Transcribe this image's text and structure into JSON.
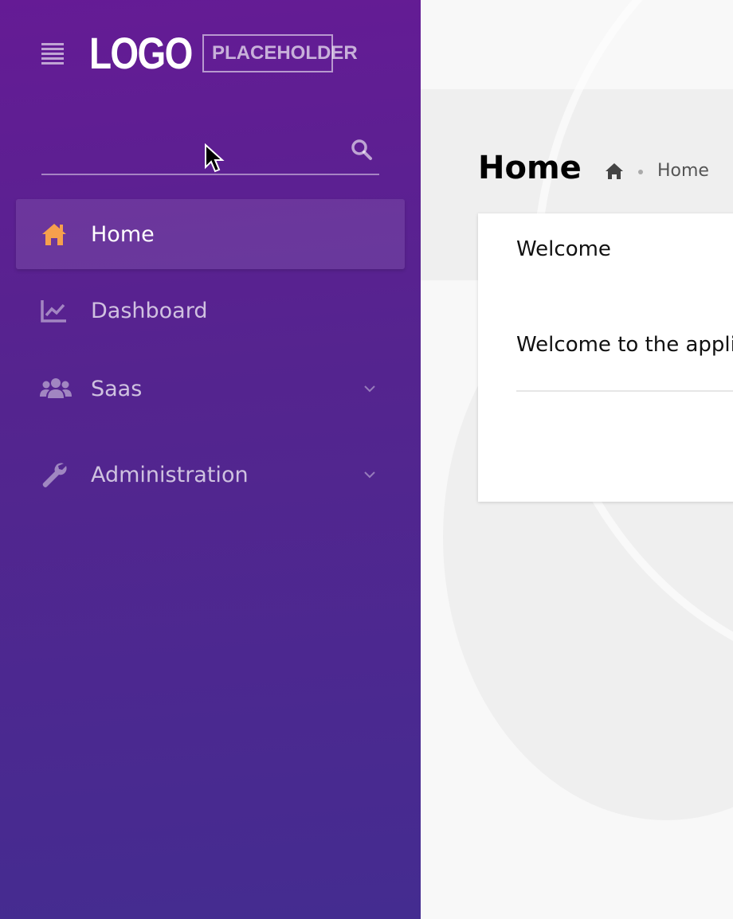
{
  "logo": {
    "main": "LOGO",
    "sub": "PLACEHOLDER"
  },
  "search": {
    "value": "",
    "placeholder": ""
  },
  "nav": {
    "items": [
      {
        "label": "Home",
        "icon": "home-icon",
        "active": true
      },
      {
        "label": "Dashboard",
        "icon": "chart-line-icon",
        "active": false
      },
      {
        "label": "Saas",
        "icon": "users-icon",
        "active": false,
        "has_submenu": true
      },
      {
        "label": "Administration",
        "icon": "wrench-icon",
        "active": false,
        "has_submenu": true
      }
    ]
  },
  "page": {
    "title": "Home",
    "breadcrumb": [
      "Home"
    ]
  },
  "card": {
    "title": "Welcome",
    "body": "Welcome to the application!"
  },
  "colors": {
    "sidebar_top": "#651b95",
    "sidebar_bottom": "#442c90",
    "active_icon": "#f6a04d",
    "content_bg": "#f8f8f8"
  }
}
